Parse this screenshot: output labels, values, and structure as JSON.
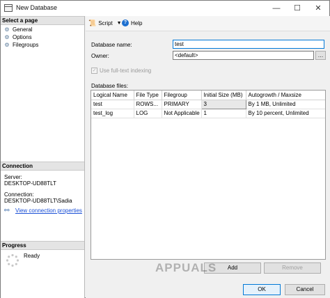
{
  "window": {
    "title": "New Database"
  },
  "sidebar": {
    "select_page_header": "Select a page",
    "pages": [
      {
        "label": "General",
        "icon": "wrench-icon"
      },
      {
        "label": "Options",
        "icon": "wrench-icon"
      },
      {
        "label": "Filegroups",
        "icon": "wrench-icon"
      }
    ],
    "connection_header": "Connection",
    "server_label": "Server:",
    "server_value": "DESKTOP-UD88TLT",
    "connection_label": "Connection:",
    "connection_value": "DESKTOP-UD88TLT\\Sadia",
    "view_link": "View connection properties",
    "progress_header": "Progress",
    "progress_status": "Ready"
  },
  "toolbar": {
    "script_label": "Script",
    "help_label": "Help"
  },
  "form": {
    "db_name_label": "Database name:",
    "db_name_value": "test",
    "owner_label": "Owner:",
    "owner_value": "<default>",
    "fulltext_label": "Use full-text indexing",
    "db_files_label": "Database files:"
  },
  "files_table": {
    "columns": [
      "Logical Name",
      "File Type",
      "Filegroup",
      "Initial Size (MB)",
      "Autogrowth / Maxsize"
    ],
    "rows": [
      [
        "test",
        "ROWS...",
        "PRIMARY",
        "3",
        "By 1 MB, Unlimited"
      ],
      [
        "test_log",
        "LOG",
        "Not Applicable",
        "1",
        "By 10 percent, Unlimited"
      ]
    ]
  },
  "buttons": {
    "add": "Add",
    "remove": "Remove",
    "ok": "OK",
    "cancel": "Cancel"
  },
  "watermark": "APPUALS",
  "colors": {
    "accent": "#0078d7",
    "link": "#1a4fd6"
  }
}
